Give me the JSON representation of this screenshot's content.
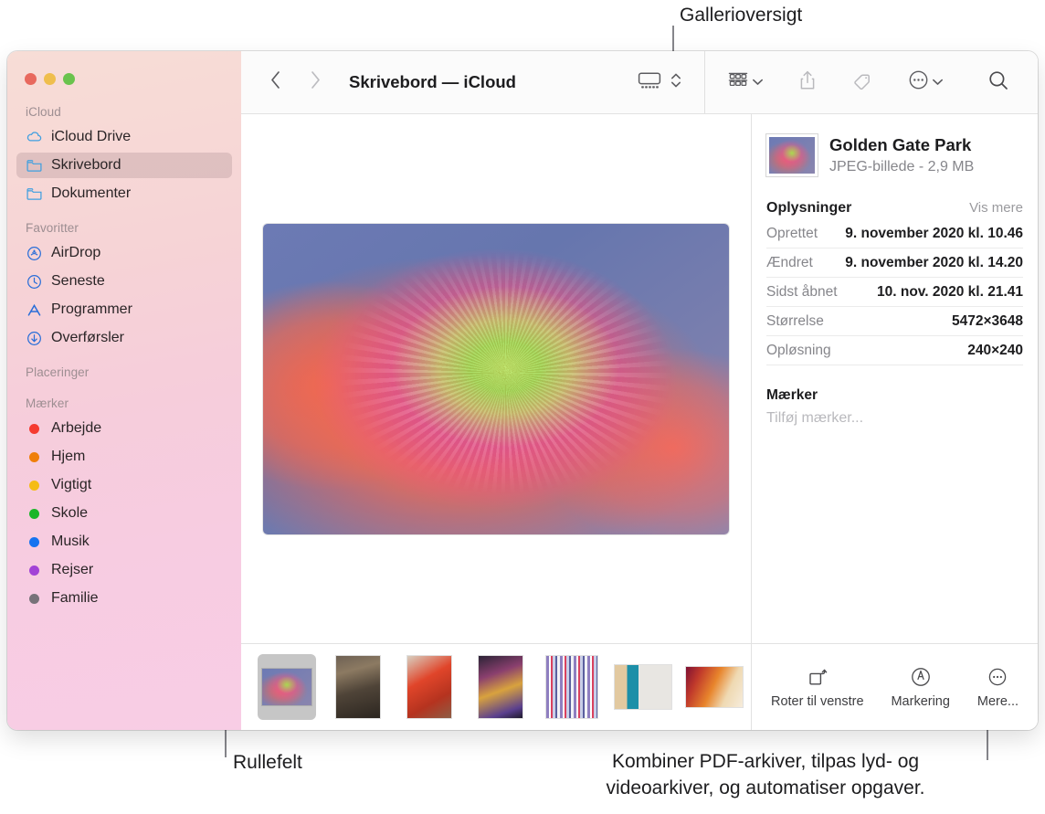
{
  "callouts": {
    "gallery": "Gallerioversigt",
    "scrollbar": "Rullefelt",
    "quick_actions": "Kombiner PDF-arkiver, tilpas lyd- og\nvideoarkiver, og automatiser opgaver."
  },
  "window": {
    "traffic_lights": {
      "close": "#e8695e",
      "minimize": "#efbe4d",
      "zoom": "#6ac34d"
    }
  },
  "sidebar": {
    "sections": [
      {
        "title": "iCloud",
        "items": [
          {
            "label": "iCloud Drive",
            "icon": "cloud-icon",
            "selected": false
          },
          {
            "label": "Skrivebord",
            "icon": "folder-icon",
            "selected": true
          },
          {
            "label": "Dokumenter",
            "icon": "folder-icon",
            "selected": false
          }
        ]
      },
      {
        "title": "Favoritter",
        "items": [
          {
            "label": "AirDrop",
            "icon": "airdrop-icon",
            "selected": false
          },
          {
            "label": "Seneste",
            "icon": "clock-icon",
            "selected": false
          },
          {
            "label": "Programmer",
            "icon": "applications-icon",
            "selected": false
          },
          {
            "label": "Overførsler",
            "icon": "downloads-icon",
            "selected": false
          }
        ]
      },
      {
        "title": "Placeringer",
        "items": []
      },
      {
        "title": "Mærker",
        "items": [
          {
            "label": "Arbejde",
            "icon": "tag-dot-icon",
            "color": "#f53b30"
          },
          {
            "label": "Hjem",
            "icon": "tag-dot-icon",
            "color": "#ef7f0a"
          },
          {
            "label": "Vigtigt",
            "icon": "tag-dot-icon",
            "color": "#f5bc14"
          },
          {
            "label": "Skole",
            "icon": "tag-dot-icon",
            "color": "#1bb629"
          },
          {
            "label": "Musik",
            "icon": "tag-dot-icon",
            "color": "#1673f0"
          },
          {
            "label": "Rejser",
            "icon": "tag-dot-icon",
            "color": "#a243d6"
          },
          {
            "label": "Familie",
            "icon": "tag-dot-icon",
            "color": "#777279"
          }
        ]
      }
    ]
  },
  "toolbar": {
    "back_icon": "chevron-left-icon",
    "forward_icon": "chevron-right-icon",
    "title": "Skrivebord — iCloud",
    "view_icon": "gallery-view-icon",
    "view_stepper_icon": "chevron-updown-icon",
    "group_icon": "group-by-icon",
    "group_chevron_icon": "chevron-down-icon",
    "share_icon": "share-icon",
    "tag_icon": "tag-icon",
    "more_icon": "ellipsis-circle-icon",
    "more_chevron_icon": "chevron-down-icon",
    "search_icon": "search-icon"
  },
  "preview": {
    "photo_name": "Golden Gate Park"
  },
  "scrubber": {
    "thumbnails": [
      {
        "name": "Golden Gate Park",
        "selected": true,
        "orientation": "landscape"
      },
      {
        "name": "forest-path",
        "selected": false,
        "orientation": "portrait"
      },
      {
        "name": "red-hands",
        "selected": false,
        "orientation": "portrait"
      },
      {
        "name": "portrait-neon",
        "selected": false,
        "orientation": "portrait"
      },
      {
        "name": "striped-figure",
        "selected": false,
        "orientation": "portrait"
      },
      {
        "name": "louisa-paris",
        "selected": false,
        "orientation": "landscape"
      },
      {
        "name": "gradient-streak",
        "selected": false,
        "orientation": "landscape"
      },
      {
        "name": "marketing-plan",
        "selected": false,
        "orientation": "portrait"
      }
    ]
  },
  "info_panel": {
    "file_title": "Golden Gate Park",
    "file_subtitle": "JPEG-billede - 2,9 MB",
    "details_heading": "Oplysninger",
    "show_more_label": "Vis mere",
    "rows": [
      {
        "key": "Oprettet",
        "value": "9. november 2020 kl. 10.46"
      },
      {
        "key": "Ændret",
        "value": "9. november 2020 kl. 14.20"
      },
      {
        "key": "Sidst åbnet",
        "value": "10. nov. 2020 kl. 21.41"
      },
      {
        "key": "Størrelse",
        "value": "5472×3648"
      },
      {
        "key": "Opløsning",
        "value": "240×240"
      }
    ],
    "tags_heading": "Mærker",
    "tags_placeholder": "Tilføj mærker..."
  },
  "quick_actions": [
    {
      "label": "Roter til venstre",
      "icon": "rotate-left-icon"
    },
    {
      "label": "Markering",
      "icon": "markup-icon"
    },
    {
      "label": "Mere...",
      "icon": "ellipsis-circle-icon"
    }
  ]
}
